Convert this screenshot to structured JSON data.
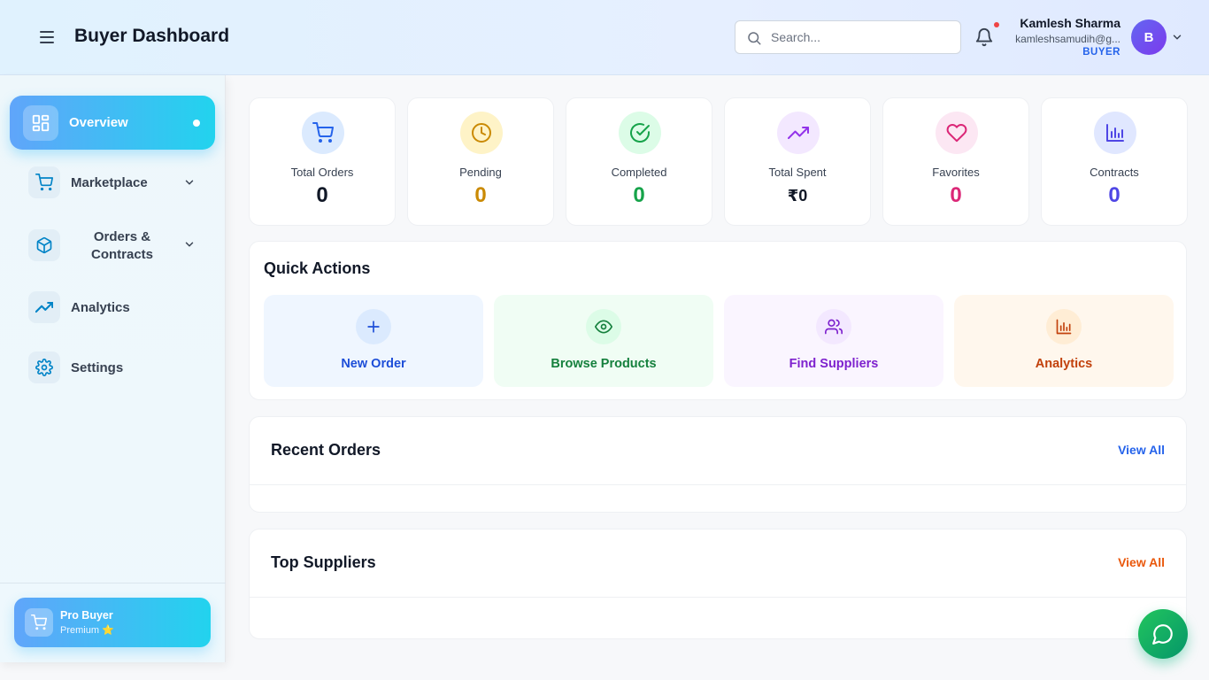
{
  "header": {
    "title": "Buyer Dashboard",
    "search_placeholder": "Search...",
    "user": {
      "name": "Kamlesh Sharma",
      "email": "kamleshsamudih@g...",
      "role": "BUYER",
      "avatar_initial": "B"
    }
  },
  "sidebar": {
    "items": [
      {
        "label": "Overview",
        "icon": "layout-grid-icon",
        "active": true
      },
      {
        "label": "Marketplace",
        "icon": "cart-icon",
        "has_submenu": true
      },
      {
        "label": "Orders &",
        "label2": "Contracts",
        "icon": "box-icon",
        "has_submenu": true
      },
      {
        "label": "Analytics",
        "icon": "trending-up-icon"
      },
      {
        "label": "Settings",
        "icon": "gear-icon"
      }
    ],
    "pro": {
      "title": "Pro Buyer",
      "subtitle": "Premium ⭐"
    }
  },
  "stats": [
    {
      "label": "Total Orders",
      "value": "0",
      "color": "#111827",
      "bg": "#dbeafe",
      "icon_color": "#2563eb"
    },
    {
      "label": "Pending",
      "value": "0",
      "color": "#ca8a04",
      "bg": "#fef3c7",
      "icon_color": "#ca8a04"
    },
    {
      "label": "Completed",
      "value": "0",
      "color": "#16a34a",
      "bg": "#dcfce7",
      "icon_color": "#16a34a"
    },
    {
      "label": "Total Spent",
      "value": "₹0",
      "color": "#111827",
      "bg": "#f3e8ff",
      "icon_color": "#9333ea"
    },
    {
      "label": "Favorites",
      "value": "0",
      "color": "#db2777",
      "bg": "#fce7f3",
      "icon_color": "#db2777"
    },
    {
      "label": "Contracts",
      "value": "0",
      "color": "#4f46e5",
      "bg": "#e0e7ff",
      "icon_color": "#4f46e5"
    }
  ],
  "quick_actions": {
    "title": "Quick Actions",
    "items": [
      {
        "label": "New Order",
        "bg": "#eff6ff",
        "circle": "#dbeafe",
        "color": "#1d4ed8"
      },
      {
        "label": "Browse Products",
        "bg": "#f0fdf4",
        "circle": "#dcfce7",
        "color": "#15803d"
      },
      {
        "label": "Find Suppliers",
        "bg": "#faf5ff",
        "circle": "#f3e8ff",
        "color": "#7e22ce"
      },
      {
        "label": "Analytics",
        "bg": "#fff7ed",
        "circle": "#ffedd5",
        "color": "#c2410c"
      }
    ]
  },
  "recent_orders": {
    "title": "Recent Orders",
    "view_all": "View All",
    "link_color": "#2563eb"
  },
  "top_suppliers": {
    "title": "Top Suppliers",
    "view_all": "View All",
    "link_color": "#ea580c"
  }
}
